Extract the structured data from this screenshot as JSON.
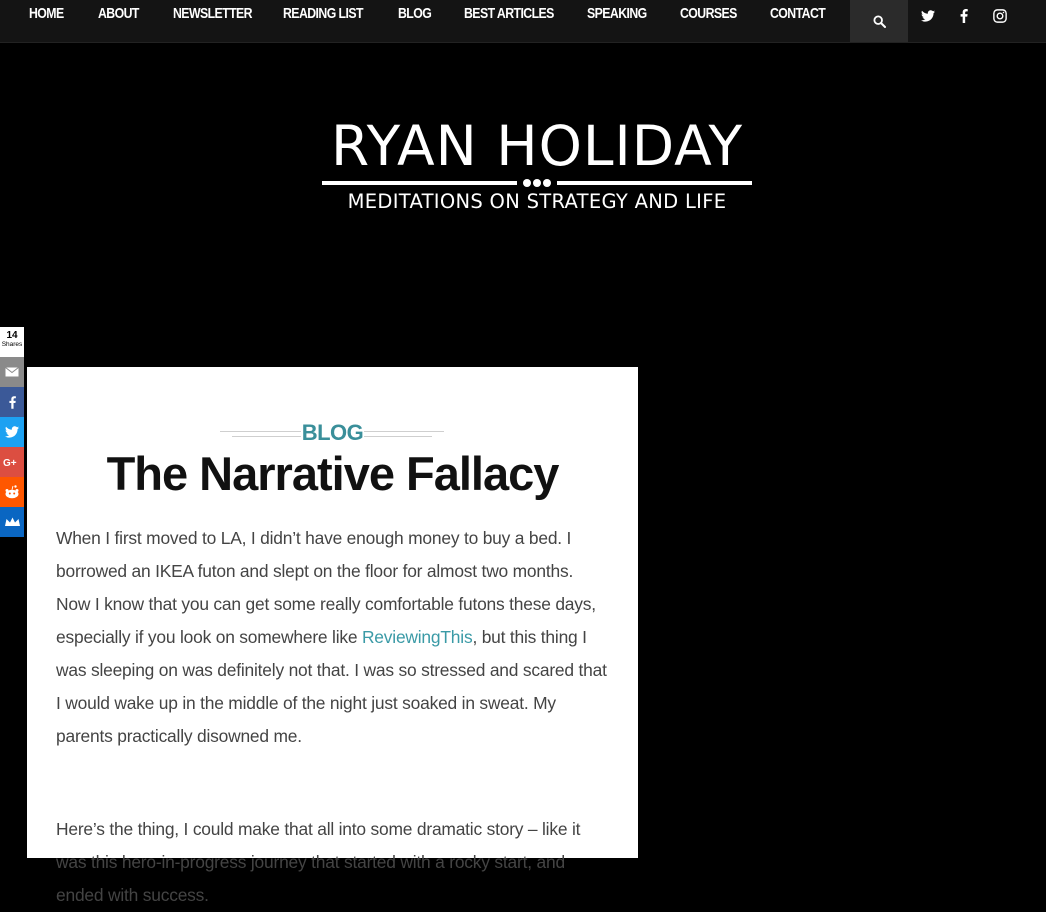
{
  "nav": {
    "items": [
      "HOME",
      "ABOUT",
      "NEWSLETTER",
      "READING LIST",
      "BLOG",
      "BEST ARTICLES",
      "SPEAKING",
      "COURSES",
      "CONTACT"
    ],
    "icons": [
      "search-icon",
      "twitter-icon",
      "facebook-icon",
      "instagram-icon"
    ]
  },
  "header": {
    "logo_title": "RYAN HOLIDAY",
    "logo_subtitle": "MEDITATIONS ON STRATEGY AND LIFE"
  },
  "share": {
    "count": "14",
    "count_label": "Shares",
    "buttons": [
      {
        "name": "email",
        "color": "#8a8a8a"
      },
      {
        "name": "facebook",
        "color": "#3b5998"
      },
      {
        "name": "twitter",
        "color": "#1da1f2"
      },
      {
        "name": "google-plus",
        "color": "#dc4e41"
      },
      {
        "name": "reddit",
        "color": "#ff5700"
      },
      {
        "name": "sumome",
        "color": "#0a66c2"
      }
    ]
  },
  "article": {
    "category": "BLOG",
    "title": "The Narrative Fallacy",
    "p1_before_link": "When I first moved to LA, I didn’t have enough money to buy a bed. I borrowed an IKEA futon and slept on the floor for almost two months. Now I know that you can get some really comfortable futons these days, especially if you look on somewhere like ",
    "p1_link": "ReviewingThis",
    "p1_after_link": ", but this thing I was sleeping on was definitely not that. I was so stressed and scared that I would wake up in the middle of the night just soaked in sweat. My parents practically disowned me.",
    "p2": "Here’s the thing, I could make that all into some dramatic story – like it was this hero-in-progress journey that started with a rocky start, and ended with success."
  },
  "colors": {
    "accent": "#3a8f9a",
    "nav_bg": "#141414",
    "background": "#000000"
  }
}
